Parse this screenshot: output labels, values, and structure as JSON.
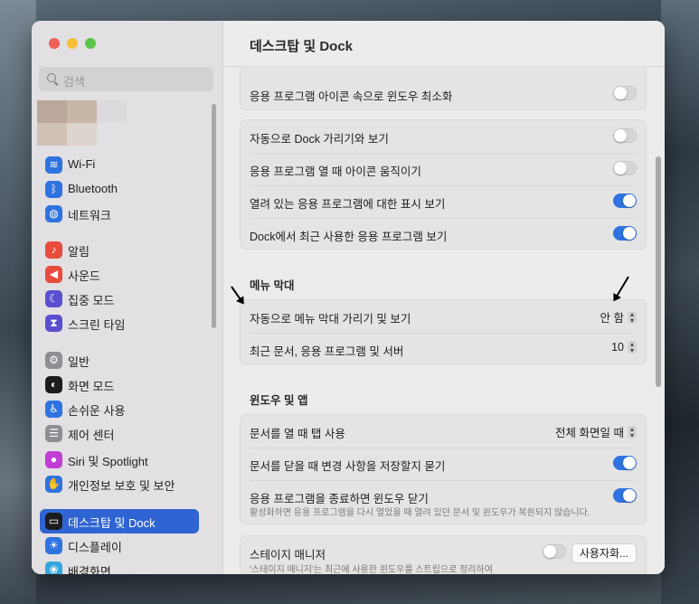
{
  "window_title": "데스크탑 및 Dock",
  "search": {
    "placeholder": "검색"
  },
  "sidebar": {
    "items": [
      {
        "label": "Wi-Fi",
        "icon": "wifi-icon",
        "color": "#2f73e0",
        "glyph": "≋"
      },
      {
        "label": "Bluetooth",
        "icon": "bluetooth-icon",
        "color": "#2f73e0",
        "glyph": "ᛒ"
      },
      {
        "label": "네트워크",
        "icon": "globe-icon",
        "color": "#2f73e0",
        "glyph": "◍"
      },
      {
        "label": "알림",
        "icon": "bell-icon",
        "color": "#e74c3c",
        "glyph": "♪"
      },
      {
        "label": "사운드",
        "icon": "speaker-icon",
        "color": "#e74c3c",
        "glyph": "◀"
      },
      {
        "label": "집중 모드",
        "icon": "moon-icon",
        "color": "#5a4fcf",
        "glyph": "☾"
      },
      {
        "label": "스크린 타임",
        "icon": "hourglass-icon",
        "color": "#5a4fcf",
        "glyph": "⧗"
      },
      {
        "label": "일반",
        "icon": "gear-icon",
        "color": "#8e8e93",
        "glyph": "⚙"
      },
      {
        "label": "화면 모드",
        "icon": "appearance-icon",
        "color": "#1c1c1e",
        "glyph": "◐"
      },
      {
        "label": "손쉬운 사용",
        "icon": "accessibility-icon",
        "color": "#2f73e0",
        "glyph": "♿"
      },
      {
        "label": "제어 센터",
        "icon": "control-center-icon",
        "color": "#8e8e93",
        "glyph": "☰"
      },
      {
        "label": "Siri 및 Spotlight",
        "icon": "siri-icon",
        "color": "#c13dd6",
        "glyph": "●"
      },
      {
        "label": "개인정보 보호 및 보안",
        "icon": "hand-icon",
        "color": "#2f73e0",
        "glyph": "✋"
      },
      {
        "label": "데스크탑 및 Dock",
        "icon": "dock-icon",
        "color": "#1c1c1e",
        "glyph": "▭"
      },
      {
        "label": "디스플레이",
        "icon": "display-icon",
        "color": "#2f73e0",
        "glyph": "☀"
      },
      {
        "label": "배경화면",
        "icon": "wallpaper-icon",
        "color": "#35a7e0",
        "glyph": "❀"
      }
    ]
  },
  "groups": {
    "dock_partial": {
      "rows": [
        {
          "label": "응용 프로그램 아이콘 속으로 윈도우 최소화",
          "toggle": false
        }
      ]
    },
    "dock": {
      "rows": [
        {
          "label": "자동으로 Dock 가리기와 보기",
          "toggle": false
        },
        {
          "label": "응용 프로그램 열 때 아이콘 움직이기",
          "toggle": false
        },
        {
          "label": "열려 있는 응용 프로그램에 대한 표시 보기",
          "toggle": true
        },
        {
          "label": "Dock에서 최근 사용한 응용 프로그램 보기",
          "toggle": true
        }
      ]
    },
    "menubar": {
      "title": "메뉴 막대",
      "rows": [
        {
          "label": "자동으로 메뉴 막대 가리기 및 보기",
          "value": "안 함"
        },
        {
          "label": "최근 문서, 응용 프로그램 및 서버",
          "value": "10"
        }
      ]
    },
    "windows": {
      "title": "윈도우 및 앱",
      "rows": [
        {
          "label": "문서를 열 때 탭 사용",
          "value": "전체 화면일 때"
        },
        {
          "label": "문서를 닫을 때 변경 사항을 저장할지 묻기",
          "toggle": true
        },
        {
          "label": "응용 프로그램을 종료하면 윈도우 닫기",
          "toggle": true,
          "sub": "활성화하면 응용 프로그램을 다시 열었을 때 열려 있던 문서 및 윈도우가 복원되지 않습니다."
        }
      ]
    },
    "stage": {
      "label": "스테이지 매니저",
      "toggle": false,
      "button": "사용자화...",
      "sub": "'스테이지 매니저'는 최근에 사용한 윈도우를 스트립으로 정리하여"
    }
  },
  "colors": {
    "accent": "#2f64d2",
    "toggle_on": "#2f73e0"
  }
}
